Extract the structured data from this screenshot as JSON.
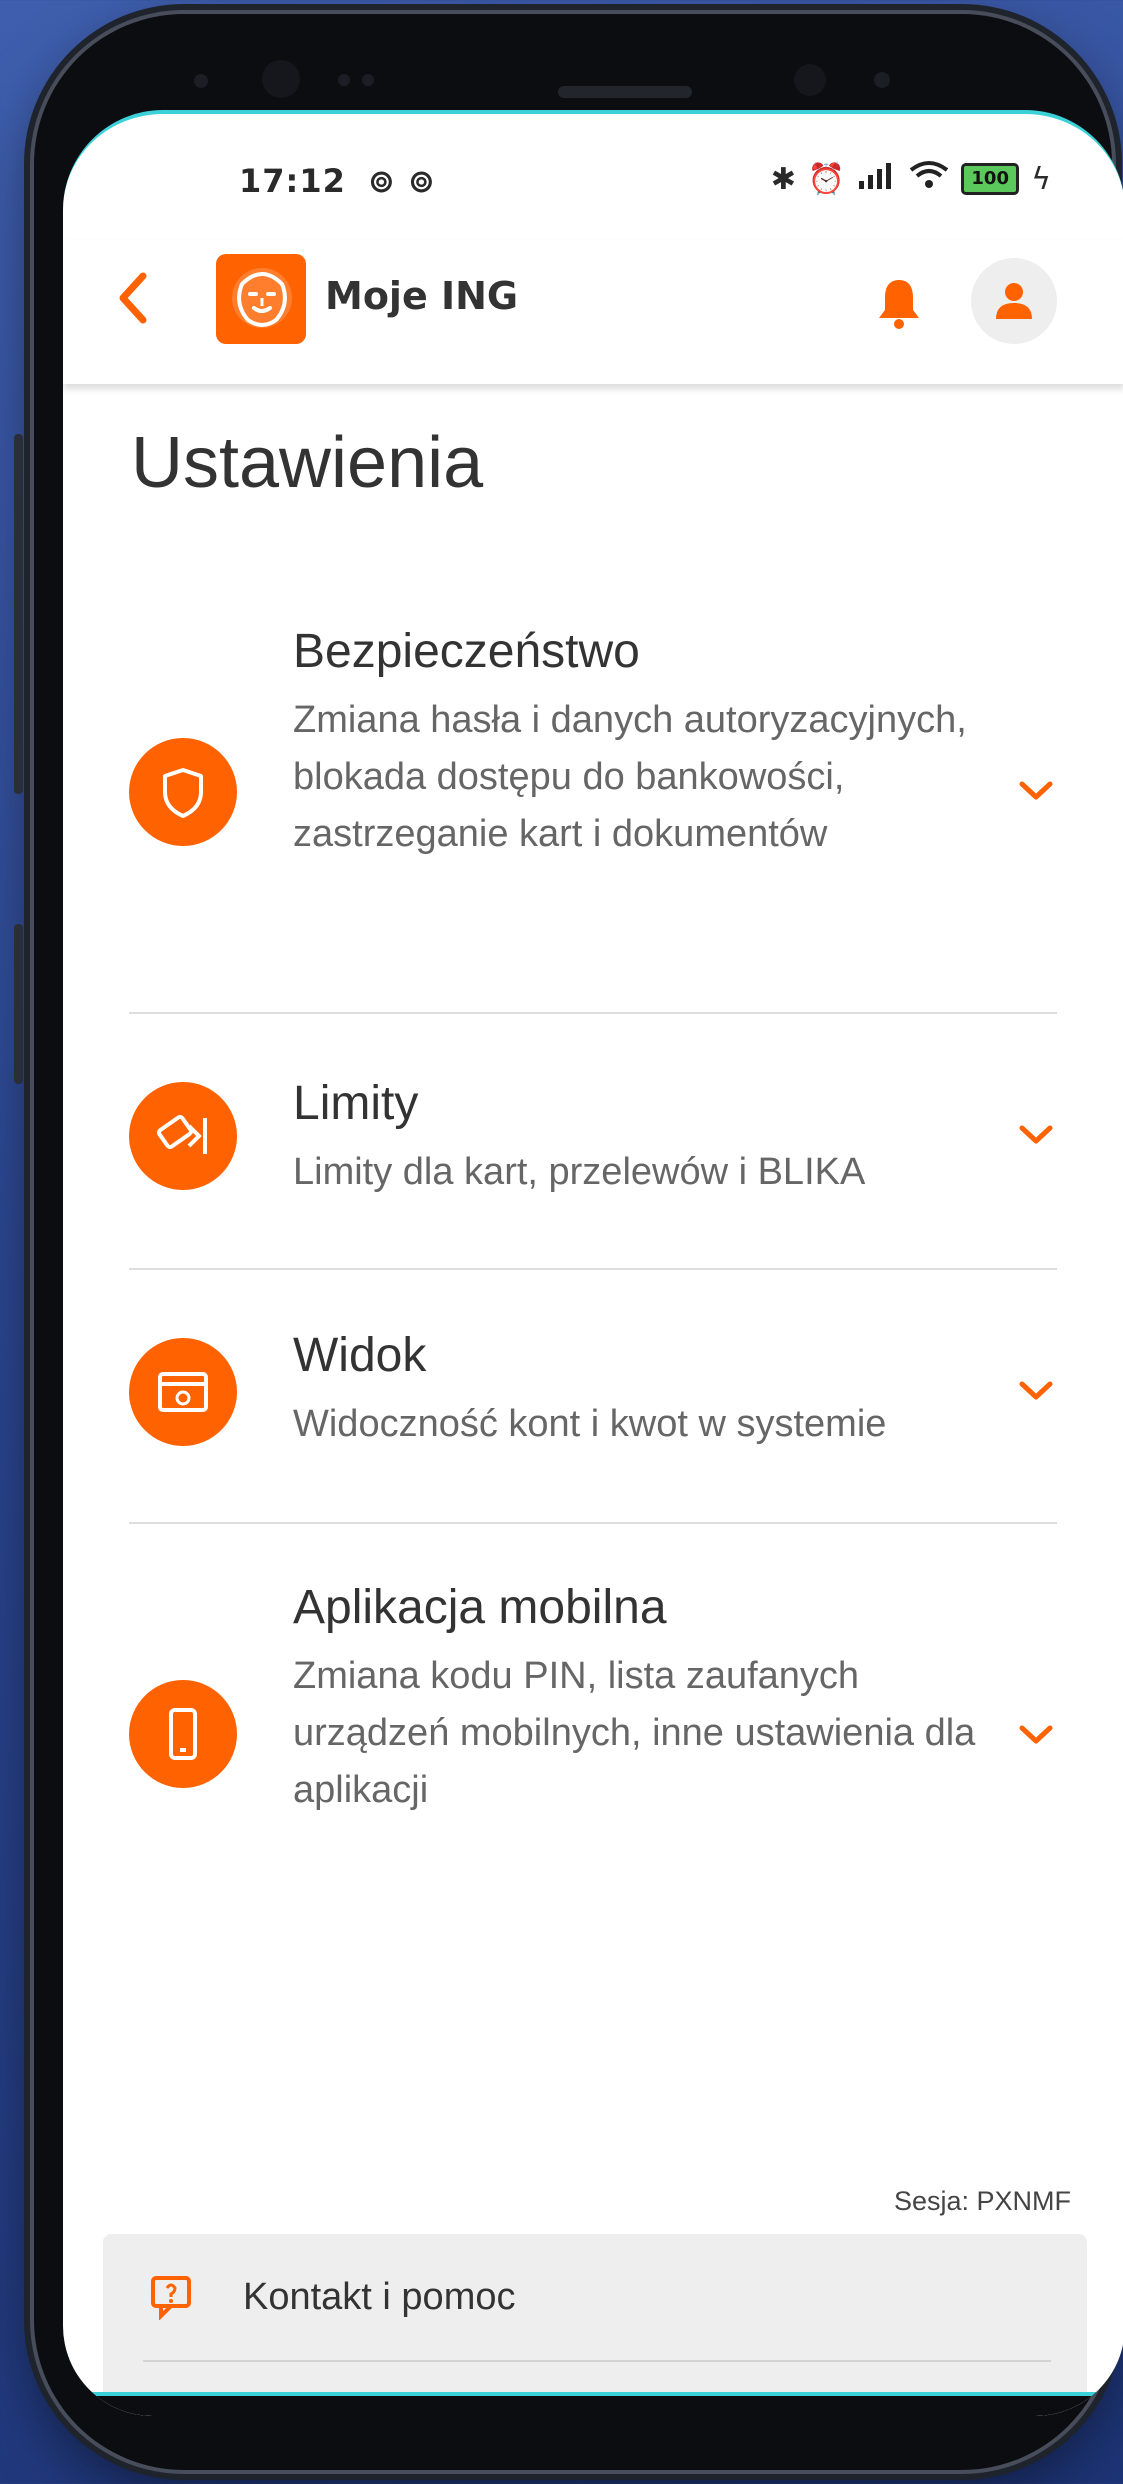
{
  "status_bar": {
    "time": "17:12",
    "battery": "100"
  },
  "app_bar": {
    "title": "Moje ING"
  },
  "page": {
    "title": "Ustawienia"
  },
  "settings_items": [
    {
      "title": "Bezpieczeństwo",
      "description": "Zmiana hasła i danych autoryzacyjnych, blokada dostępu do bankowości, zastrzeganie kart i dokumentów",
      "icon": "shield-icon"
    },
    {
      "title": "Limity",
      "description": "Limity dla kart, przelewów i BLIKA",
      "icon": "card-limit-icon"
    },
    {
      "title": "Widok",
      "description": "Widoczność kont i kwot w systemie",
      "icon": "view-settings-icon"
    },
    {
      "title": "Aplikacja mobilna",
      "description": "Zmiana kodu PIN, lista zaufanych urządzeń mobilnych, inne ustawienia dla aplikacji",
      "icon": "mobile-phone-icon"
    }
  ],
  "session": {
    "label": "Sesja: PXNMF"
  },
  "footer": {
    "items": [
      {
        "label": "Kontakt i pomoc",
        "icon": "help-chat-icon"
      }
    ]
  },
  "colors": {
    "accent": "#ff6200",
    "text_primary": "#333333",
    "text_secondary": "#666666"
  }
}
